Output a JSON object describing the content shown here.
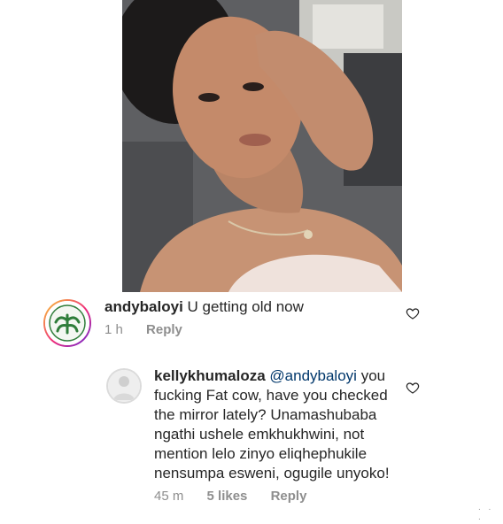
{
  "post": {
    "image_alt": "photo of a woman reclining"
  },
  "comments": [
    {
      "username": "andybaloyi",
      "text": "U getting old now",
      "time": "1 h",
      "reply_label": "Reply",
      "avatar_icon": "green-plant-emblem-avatar"
    },
    {
      "username": "kellykhumaloza",
      "mention": "@andybaloyi",
      "text": "you fucking Fat cow, have you checked the mirror lately? Unamashubaba ngathi ushele emkhukhwini, not mention lelo zinyo eliqhephukile nensumpa esweni, ogugile unyoko!",
      "time": "45 m",
      "likes": "5 likes",
      "reply_label": "Reply",
      "avatar_icon": "user-photo-avatar"
    }
  ],
  "icons": {
    "like": "heart-outline-icon"
  },
  "colors": {
    "meta": "#8e8e8e",
    "text": "#262626",
    "mention": "#00376b"
  }
}
